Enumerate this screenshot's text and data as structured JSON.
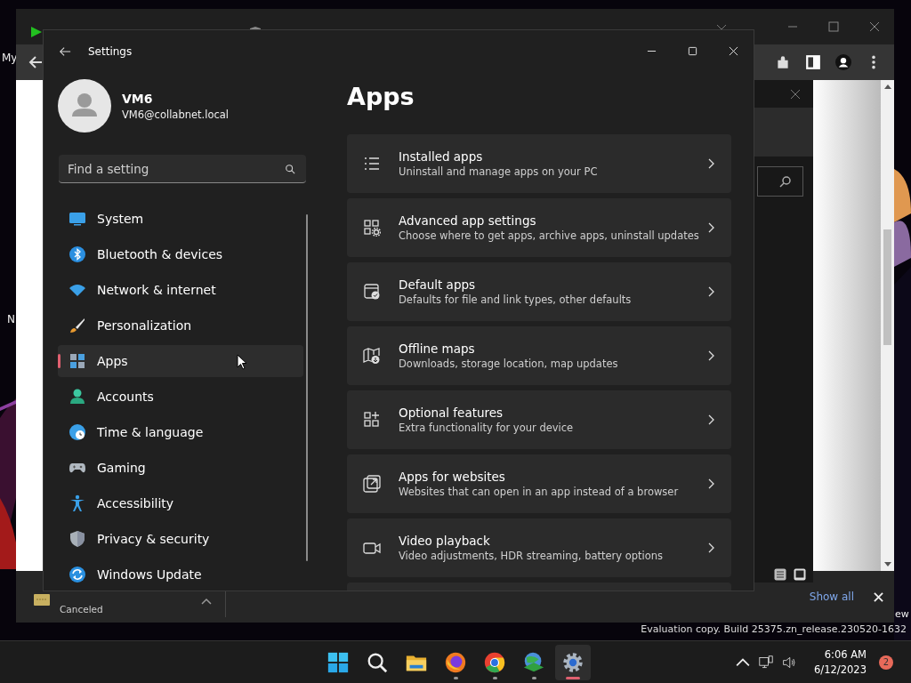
{
  "desktop": {
    "labels": [
      "My",
      "N",
      "ew"
    ],
    "build_notice": "Evaluation copy. Build 25375.zn_release.230520-1632"
  },
  "browser": {
    "download": {
      "status": "Canceled",
      "show_all": "Show all"
    }
  },
  "settings": {
    "title": "Settings",
    "user": {
      "name": "VM6",
      "email": "VM6@collabnet.local"
    },
    "search": {
      "placeholder": "Find a setting"
    },
    "nav": [
      {
        "label": "System",
        "selected": false
      },
      {
        "label": "Bluetooth & devices",
        "selected": false
      },
      {
        "label": "Network & internet",
        "selected": false
      },
      {
        "label": "Personalization",
        "selected": false
      },
      {
        "label": "Apps",
        "selected": true
      },
      {
        "label": "Accounts",
        "selected": false
      },
      {
        "label": "Time & language",
        "selected": false
      },
      {
        "label": "Gaming",
        "selected": false
      },
      {
        "label": "Accessibility",
        "selected": false
      },
      {
        "label": "Privacy & security",
        "selected": false
      },
      {
        "label": "Windows Update",
        "selected": false
      }
    ],
    "page_title": "Apps",
    "cards": [
      {
        "title": "Installed apps",
        "subtitle": "Uninstall and manage apps on your PC"
      },
      {
        "title": "Advanced app settings",
        "subtitle": "Choose where to get apps, archive apps, uninstall updates"
      },
      {
        "title": "Default apps",
        "subtitle": "Defaults for file and link types, other defaults"
      },
      {
        "title": "Offline maps",
        "subtitle": "Downloads, storage location, map updates"
      },
      {
        "title": "Optional features",
        "subtitle": "Extra functionality for your device"
      },
      {
        "title": "Apps for websites",
        "subtitle": "Websites that can open in an app instead of a browser"
      },
      {
        "title": "Video playback",
        "subtitle": "Video adjustments, HDR streaming, battery options"
      }
    ]
  },
  "taskbar": {
    "apps": [
      {
        "running": false,
        "active": false
      },
      {
        "running": false,
        "active": false
      },
      {
        "running": false,
        "active": false
      },
      {
        "running": true,
        "active": false
      },
      {
        "running": true,
        "active": false
      },
      {
        "running": true,
        "active": false
      },
      {
        "running": true,
        "active": true
      }
    ],
    "time": "6:06 AM",
    "date": "6/12/2023",
    "notifications": "2"
  }
}
